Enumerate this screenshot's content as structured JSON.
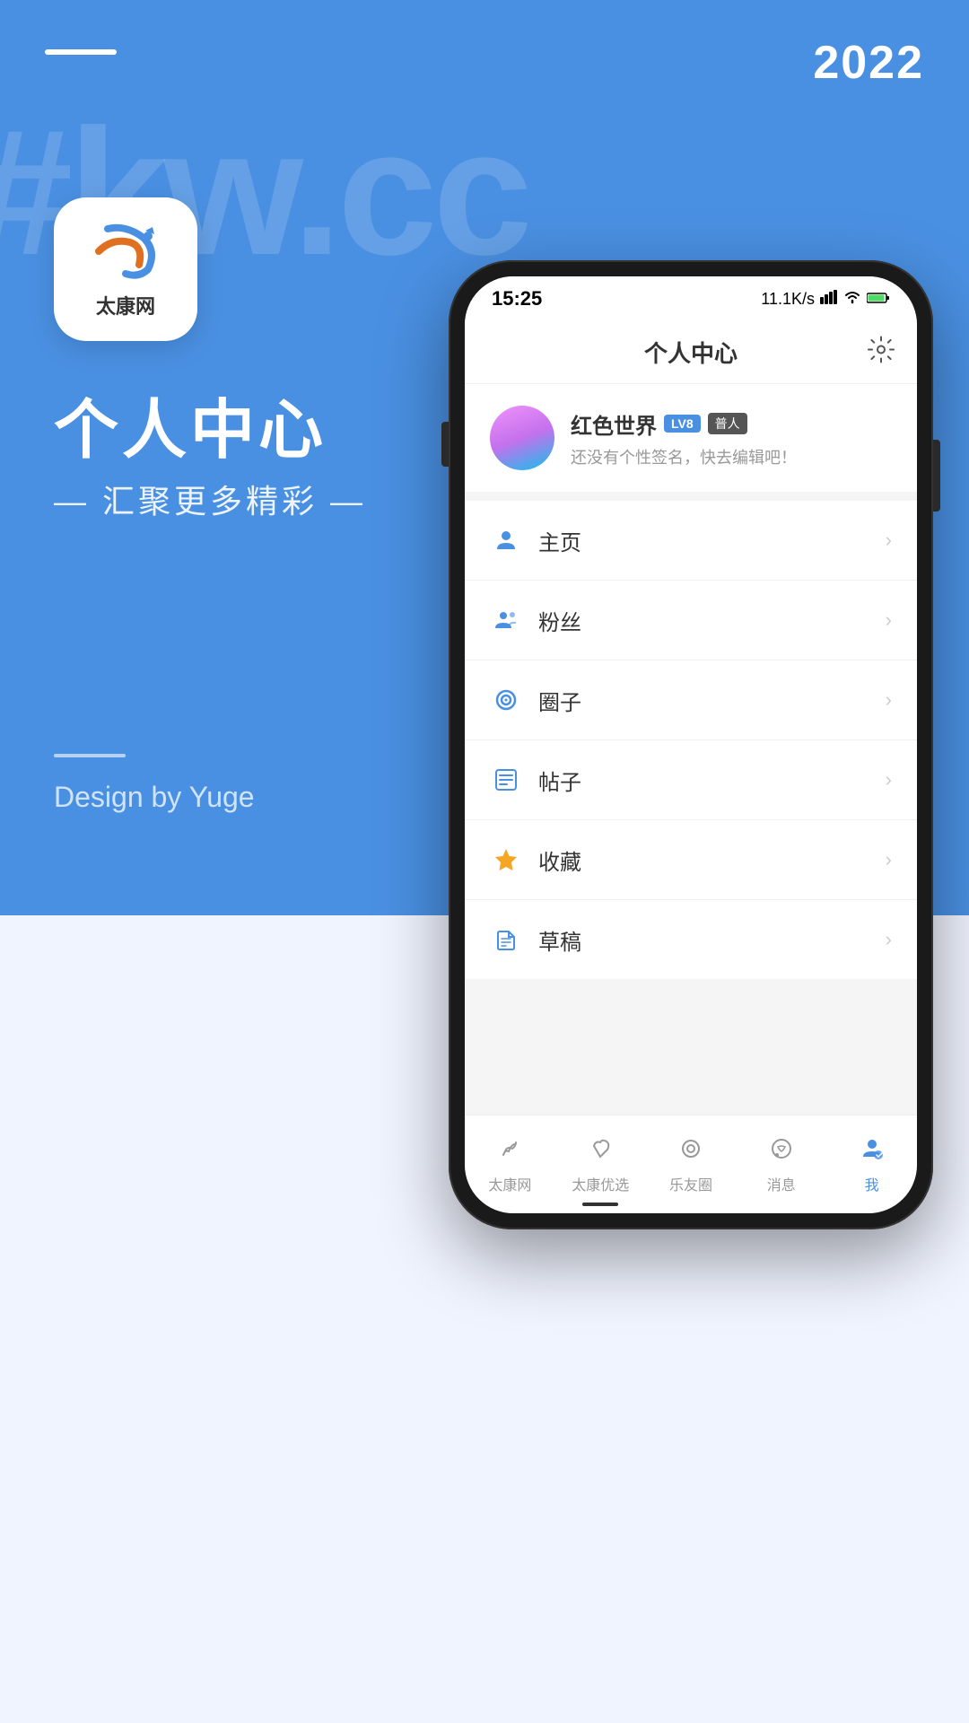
{
  "background": {
    "year": "2022",
    "watermark": "#kw.cc",
    "app_logo_text": "太康网",
    "panel_title": "个人中心",
    "panel_subtitle": "— 汇聚更多精彩 —",
    "designer": "Design by Yuge"
  },
  "phone": {
    "status_bar": {
      "time": "15:25",
      "network": "11.1K/s",
      "signal": "📶"
    },
    "header": {
      "title": "个人中心",
      "gear_label": "设置"
    },
    "profile": {
      "name": "红色世界",
      "badge_lv": "LV8",
      "badge_type": "普人",
      "bio": "还没有个性签名，快去编辑吧！"
    },
    "menu_items": [
      {
        "icon": "person",
        "label": "主页",
        "color": "#4a90e2"
      },
      {
        "icon": "fans",
        "label": "粉丝",
        "color": "#4a90e2"
      },
      {
        "icon": "circle",
        "label": "圈子",
        "color": "#4a90e2"
      },
      {
        "icon": "post",
        "label": "帖子",
        "color": "#4a90e2"
      },
      {
        "icon": "star",
        "label": "收藏",
        "color": "#f5a623"
      },
      {
        "icon": "draft",
        "label": "草稿",
        "color": "#4a90e2"
      }
    ],
    "bottom_nav": [
      {
        "label": "太康网",
        "active": false
      },
      {
        "label": "太康优选",
        "active": false
      },
      {
        "label": "乐友圈",
        "active": false
      },
      {
        "label": "消息",
        "active": false
      },
      {
        "label": "我",
        "active": true
      }
    ]
  }
}
